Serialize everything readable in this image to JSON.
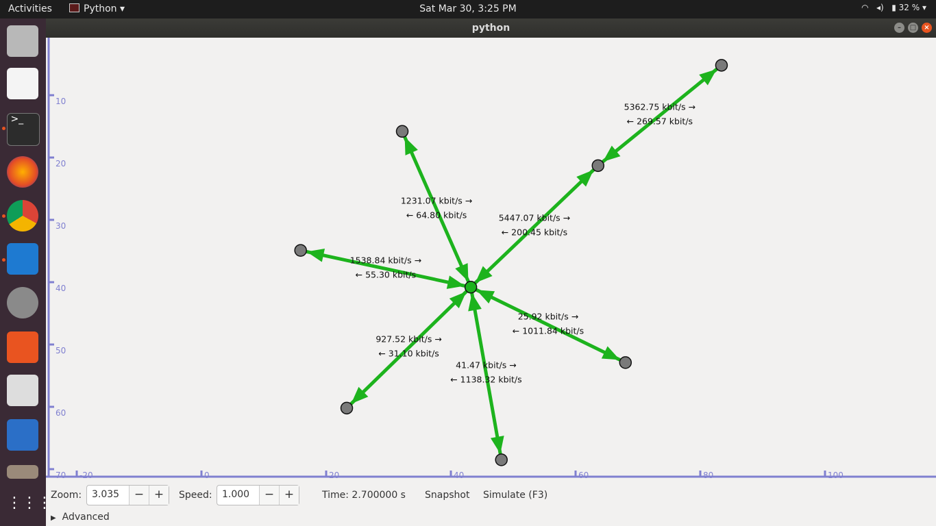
{
  "topbar": {
    "activities": "Activities",
    "app_name": "Python",
    "clock": "Sat Mar 30,  3:25 PM",
    "battery": "32 %"
  },
  "window": {
    "title": "python"
  },
  "dock": {
    "items": [
      "files-icon",
      "text-editor-icon",
      "terminal-icon",
      "firefox-icon",
      "chrome-icon",
      "vscode-icon",
      "settings-tools-icon",
      "software-center-icon",
      "office-icon",
      "tasks-icon",
      "folder-icon",
      "app-grid-icon"
    ]
  },
  "axes": {
    "y_ticks": [
      {
        "v": 10,
        "label": "10"
      },
      {
        "v": 20,
        "label": "20"
      },
      {
        "v": 30,
        "label": "30"
      },
      {
        "v": 40,
        "label": "40"
      },
      {
        "v": 50,
        "label": "50"
      },
      {
        "v": 60,
        "label": "60"
      },
      {
        "v": 70,
        "label": "70"
      }
    ],
    "x_ticks": [
      {
        "v": -20,
        "label": "-20"
      },
      {
        "v": 0,
        "label": "0"
      },
      {
        "v": 20,
        "label": "20"
      },
      {
        "v": 40,
        "label": "40"
      },
      {
        "v": 60,
        "label": "60"
      },
      {
        "v": 80,
        "label": "80"
      },
      {
        "v": 100,
        "label": "100"
      }
    ]
  },
  "network": {
    "nodes": [
      {
        "id": "center",
        "x": 43.2,
        "y": 40.8
      },
      {
        "id": "n1",
        "x": 32.2,
        "y": 15.8
      },
      {
        "id": "n2",
        "x": 15.9,
        "y": 34.9
      },
      {
        "id": "n3",
        "x": 23.3,
        "y": 60.2
      },
      {
        "id": "n4",
        "x": 48.1,
        "y": 68.5
      },
      {
        "id": "n5",
        "x": 68.0,
        "y": 52.9
      },
      {
        "id": "n6",
        "x": 63.6,
        "y": 21.3
      },
      {
        "id": "n7",
        "x": 83.4,
        "y": 5.2
      }
    ],
    "links": [
      {
        "from": "center",
        "to": "n1",
        "fwd": "1231.07 kbit/s →",
        "back": "← 64.80 kbit/s"
      },
      {
        "from": "center",
        "to": "n2",
        "fwd": "1538.84 kbit/s →",
        "back": "← 55.30 kbit/s"
      },
      {
        "from": "center",
        "to": "n3",
        "fwd": "927.52 kbit/s →",
        "back": "← 31.10 kbit/s"
      },
      {
        "from": "center",
        "to": "n4",
        "fwd": "41.47 kbit/s →",
        "back": "← 1138.32 kbit/s"
      },
      {
        "from": "center",
        "to": "n5",
        "fwd": "25.92 kbit/s →",
        "back": "← 1011.84 kbit/s"
      },
      {
        "from": "center",
        "to": "n6",
        "fwd": "5447.07 kbit/s →",
        "back": "← 200.45 kbit/s"
      },
      {
        "from": "n6",
        "to": "n7",
        "fwd": "5362.75 kbit/s →",
        "back": "← 269.57 kbit/s"
      }
    ]
  },
  "controls": {
    "zoom_label": "Zoom:",
    "zoom_value": "3.035",
    "speed_label": "Speed:",
    "speed_value": "1.000",
    "minus": "−",
    "plus": "+",
    "time": "Time: 2.700000 s",
    "snapshot": "Snapshot",
    "simulate": "Simulate (F3)",
    "advanced": "Advanced"
  },
  "colors": {
    "link": "#1db31d",
    "node_fill": "#7a7a7a",
    "axis": "#8080d0"
  }
}
